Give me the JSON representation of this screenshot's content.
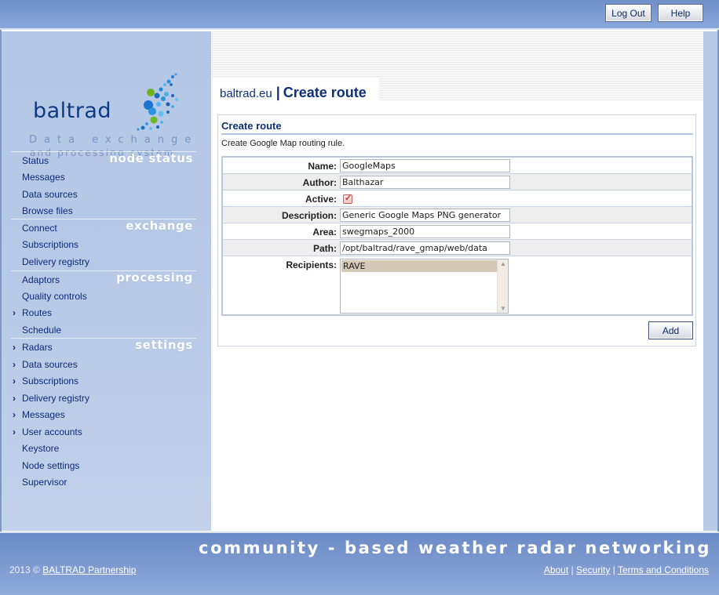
{
  "header": {
    "logout_label": "Log Out",
    "help_label": "Help"
  },
  "logo": {
    "word": "baltrad",
    "sub1": "Data exchange",
    "sub2": "and processing system"
  },
  "nav": {
    "node_status": {
      "heading": "node status",
      "items": [
        {
          "label": "Status",
          "chevron": false
        },
        {
          "label": "Messages",
          "chevron": false
        },
        {
          "label": "Data sources",
          "chevron": false
        },
        {
          "label": "Browse files",
          "chevron": false
        }
      ]
    },
    "exchange": {
      "heading": "exchange",
      "items": [
        {
          "label": "Connect",
          "chevron": false
        },
        {
          "label": "Subscriptions",
          "chevron": false
        },
        {
          "label": "Delivery registry",
          "chevron": false
        }
      ]
    },
    "processing": {
      "heading": "processing",
      "items": [
        {
          "label": "Adaptors",
          "chevron": false
        },
        {
          "label": "Quality controls",
          "chevron": false
        },
        {
          "label": "Routes",
          "chevron": true
        },
        {
          "label": "Schedule",
          "chevron": false
        }
      ]
    },
    "settings": {
      "heading": "settings",
      "items": [
        {
          "label": "Radars",
          "chevron": true
        },
        {
          "label": "Data sources",
          "chevron": true
        },
        {
          "label": "Subscriptions",
          "chevron": true
        },
        {
          "label": "Delivery registry",
          "chevron": true
        },
        {
          "label": "Messages",
          "chevron": true
        },
        {
          "label": "User accounts",
          "chevron": true
        },
        {
          "label": "Keystore",
          "chevron": false
        },
        {
          "label": "Node settings",
          "chevron": false
        },
        {
          "label": "Supervisor",
          "chevron": false
        }
      ]
    },
    "chevron_glyph": "›"
  },
  "breadcrumb": {
    "site": "baltrad.eu",
    "separator": "|",
    "page": "Create route"
  },
  "panel": {
    "title": "Create route",
    "description": "Create Google Map routing rule."
  },
  "form": {
    "name_label": "Name:",
    "name_value": "GoogleMaps",
    "author_label": "Author:",
    "author_value": "Balthazar",
    "active_label": "Active:",
    "active_checked": true,
    "description_label": "Description:",
    "description_value": "Generic Google Maps PNG generator",
    "area_label": "Area:",
    "area_value": "swegmaps_2000",
    "path_label": "Path:",
    "path_value": "/opt/baltrad/rave_gmap/web/data",
    "recipients_label": "Recipients:",
    "recipients_options": [
      "RAVE"
    ]
  },
  "actions": {
    "add_label": "Add"
  },
  "footer": {
    "slogan": "community - based weather radar networking",
    "copyright_prefix": "2013 © ",
    "copyright_link": "BALTRAD Partnership",
    "links": [
      "About",
      "Security",
      "Terms and Conditions"
    ],
    "link_separator": "|"
  },
  "colors": {
    "accent": "#0e2f7a",
    "nav_text": "#0b2b7a",
    "sidebar_bg": "#b7c9e6",
    "header_bg": "#7a99d0"
  }
}
